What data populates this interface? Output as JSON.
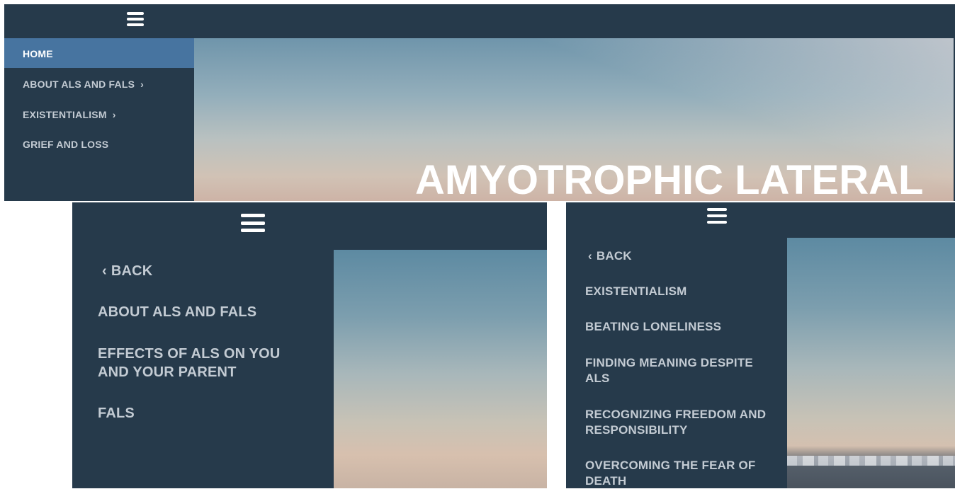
{
  "top_panel": {
    "menu": {
      "home_label": "HOME",
      "items": [
        {
          "label": "ABOUT ALS AND FALS",
          "chevron": "›"
        },
        {
          "label": "EXISTENTIALISM",
          "chevron": "›"
        },
        {
          "label": "GRIEF AND LOSS"
        }
      ]
    },
    "hero_title": "AMYOTROPHIC LATERAL"
  },
  "about_submenu": {
    "back_chevron": "‹",
    "back_label": "BACK",
    "items": [
      {
        "label": "ABOUT ALS AND FALS"
      },
      {
        "label": "EFFECTS OF ALS ON YOU AND YOUR PARENT"
      },
      {
        "label": "FALS"
      }
    ]
  },
  "existentialism_submenu": {
    "back_chevron": "‹",
    "back_label": "BACK",
    "items": [
      {
        "label": "EXISTENTIALISM"
      },
      {
        "label": "BEATING LONELINESS"
      },
      {
        "label": "FINDING MEANING DESPITE ALS"
      },
      {
        "label": "RECOGNIZING FREEDOM AND RESPONSIBILITY"
      },
      {
        "label": "OVERCOMING THE FEAR OF DEATH"
      }
    ]
  },
  "icons": {
    "menu_toggle": "hamburger-menu-icon"
  },
  "colors": {
    "nav_background": "#263a4b",
    "active_item": "#4774a0",
    "menu_text": "#c3cbd3"
  }
}
